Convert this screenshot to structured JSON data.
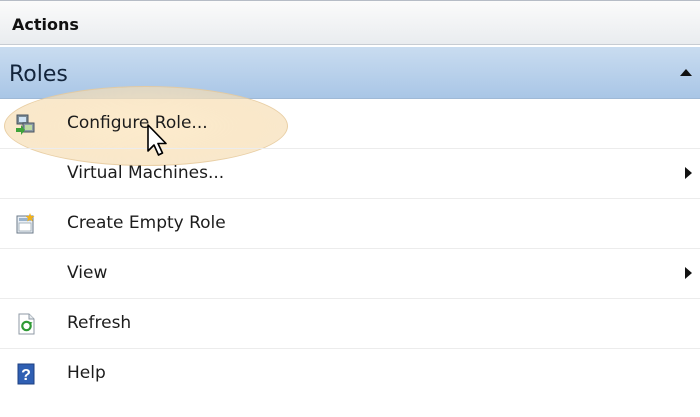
{
  "actions_header": {
    "title": "Actions"
  },
  "section": {
    "title": "Roles"
  },
  "menu": {
    "items": [
      {
        "label": "Configure Role...",
        "icon": "configure-role-icon",
        "submenu": false
      },
      {
        "label": "Virtual Machines...",
        "icon": "",
        "submenu": true
      },
      {
        "label": "Create Empty Role",
        "icon": "create-empty-role-icon",
        "submenu": false
      },
      {
        "label": "View",
        "icon": "",
        "submenu": true
      },
      {
        "label": "Refresh",
        "icon": "refresh-icon",
        "submenu": false
      },
      {
        "label": "Help",
        "icon": "help-icon",
        "submenu": false
      }
    ]
  },
  "colors": {
    "section_background": "#b9d1ec",
    "highlight": "#f8e2bc"
  }
}
